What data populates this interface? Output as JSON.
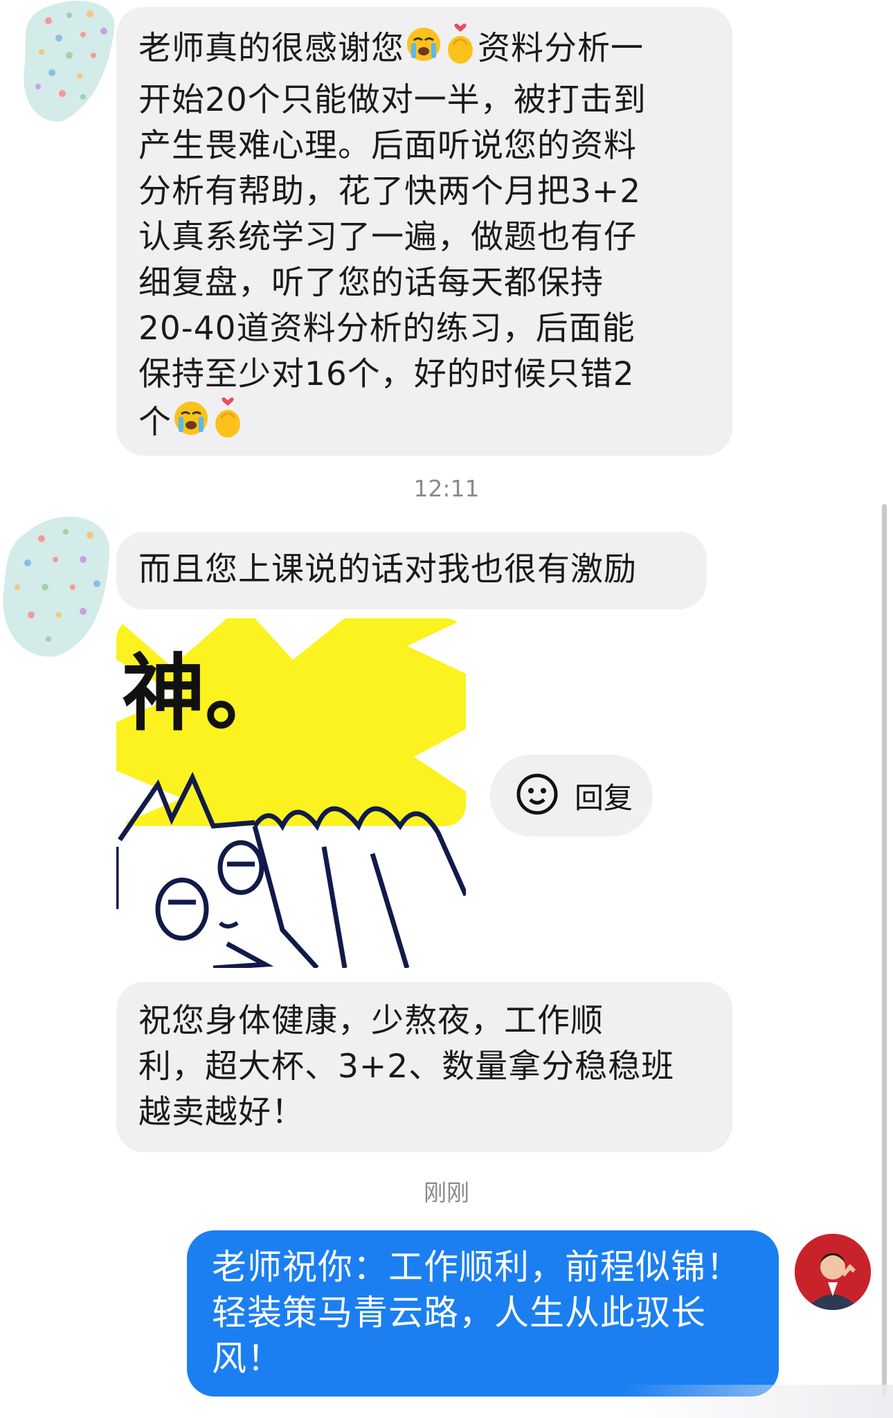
{
  "messages": [
    {
      "id": "m1",
      "sender": "student",
      "lines": [
        "老师真的很感谢您",
        "资料分析一",
        "开始20个只能做对一半，被打击到",
        "产生畏难心理。后面听说您的资料",
        "分析有帮助，花了快两个月把3+2",
        "认真系统学习了一遍，做题也有仔",
        "细复盘，听了您的话每天都保持",
        " 20-40道资料分析的练习，后面能",
        "保持至少对16个，好的时候只错2",
        "个"
      ]
    },
    {
      "id": "t1",
      "type": "timestamp",
      "text": "12:11"
    },
    {
      "id": "m2",
      "sender": "student",
      "text": "而且您上课说的话对我也很有激励"
    },
    {
      "id": "m3",
      "sender": "student",
      "type": "sticker",
      "sticker_text": "神。"
    },
    {
      "id": "m4",
      "sender": "student",
      "lines": [
        "祝您身体健康，少熬夜，工作顺",
        "利，超大杯、3+2、数量拿分稳稳班",
        "越卖越好！"
      ]
    },
    {
      "id": "t2",
      "type": "timestamp",
      "text": "刚刚"
    },
    {
      "id": "m5",
      "sender": "teacher",
      "lines": [
        "老师祝你：工作顺利，前程似锦！",
        "轻装策马青云路，人生从此驭长",
        "风！"
      ]
    }
  ],
  "reply_action": {
    "label": "回复",
    "icon": "smiley-face-icon"
  },
  "emoji": [
    "loudly-crying-face-icon",
    "finger-heart-icon"
  ],
  "colors": {
    "bubble_received": "#f0f0f2",
    "bubble_sent": "#1b7ff1",
    "sticker_sun": "#fbf21f"
  }
}
